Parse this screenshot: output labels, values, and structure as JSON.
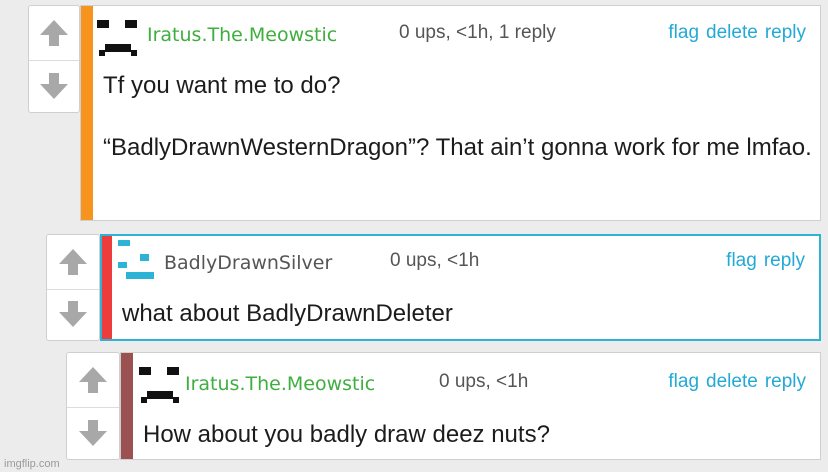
{
  "comments": [
    {
      "username": "Iratus.The.Meowstic",
      "meta": "0 ups, <1h, 1 reply",
      "actions": [
        "flag",
        "delete",
        "reply"
      ],
      "text": "Tf you want me to do?\n\n“BadlyDrawnWesternDragon”? That ain’t gonna work for me lmfao.",
      "stripe_color": "#f7941d",
      "username_color": "#3fae3f"
    },
    {
      "username": "BadlyDrawnSilver",
      "meta": "0 ups, <1h",
      "actions": [
        "flag",
        "reply"
      ],
      "text": "what about BadlyDrawnDeleter",
      "stripe_color": "#ee3b3b",
      "username_color": "#555555"
    },
    {
      "username": "Iratus.The.Meowstic",
      "meta": "0 ups, <1h",
      "actions": [
        "flag",
        "delete",
        "reply"
      ],
      "text": "How about you badly draw deez nuts?",
      "stripe_color": "#9b5151",
      "username_color": "#3fae3f"
    }
  ],
  "colors": {
    "action_link": "#23a9d6",
    "highlight_border": "#2cb3d6"
  },
  "icons": {
    "upvote": "up-arrow-icon",
    "downvote": "down-arrow-icon"
  },
  "watermark": "imgflip.com"
}
